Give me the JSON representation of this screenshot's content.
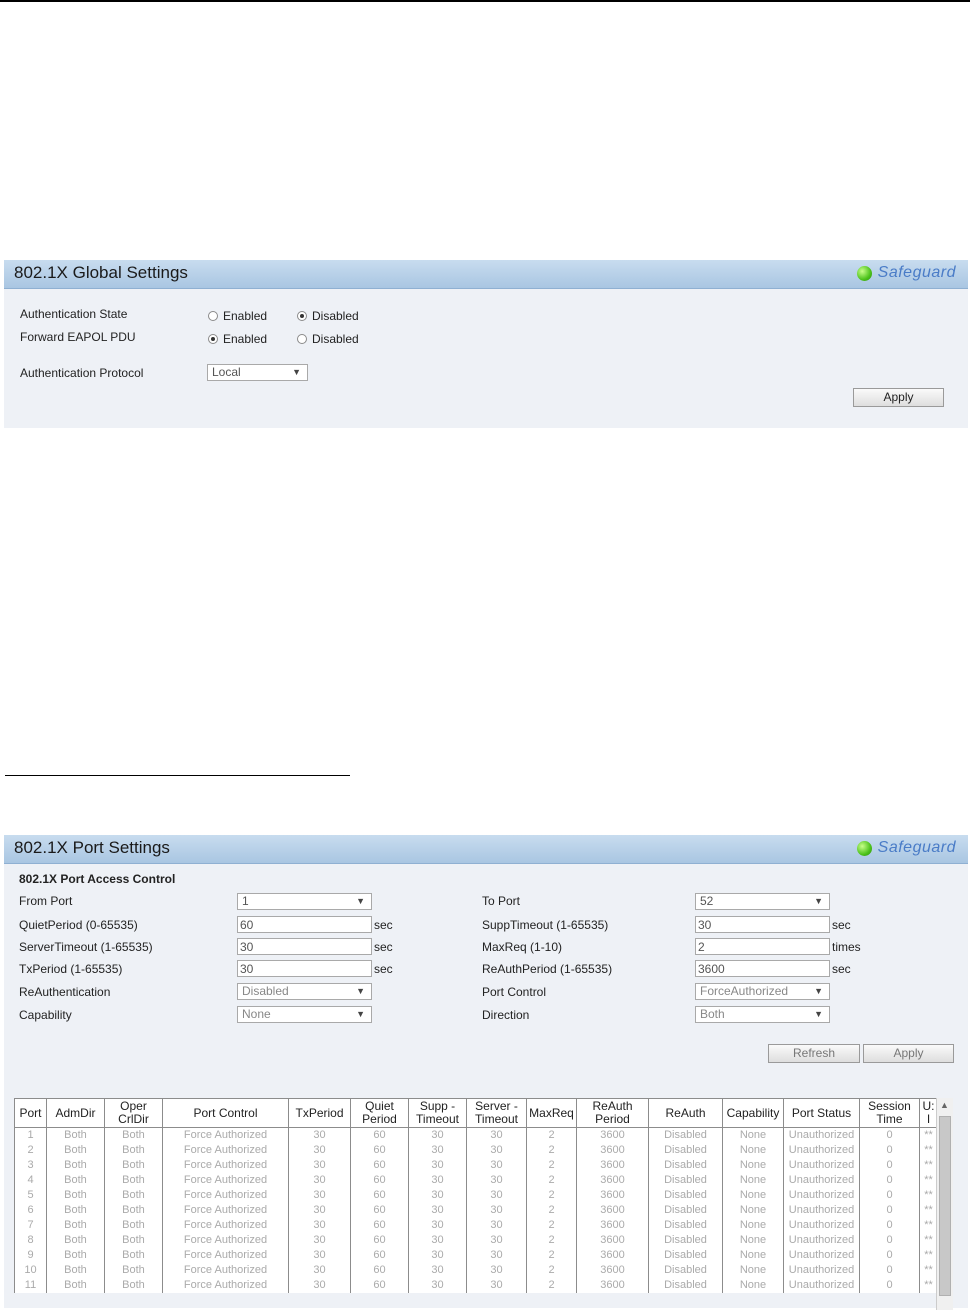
{
  "global_panel": {
    "title": "802.1X Global Settings",
    "safeguard": "Safeguard",
    "auth_state_label": "Authentication State",
    "auth_state_options": [
      "Enabled",
      "Disabled"
    ],
    "auth_state_selected": "Disabled",
    "eapol_label": "Forward EAPOL PDU",
    "eapol_options": [
      "Enabled",
      "Disabled"
    ],
    "eapol_selected": "Enabled",
    "protocol_label": "Authentication Protocol",
    "protocol_value": "Local",
    "apply": "Apply"
  },
  "port_panel": {
    "title": "802.1X Port Settings",
    "safeguard": "Safeguard",
    "section": "802.1X Port Access Control",
    "from_port_label": "From Port",
    "from_port_value": "1",
    "to_port_label": "To Port",
    "to_port_value": "52",
    "quiet_label": "QuietPeriod (0-65535)",
    "quiet_value": "60",
    "quiet_unit": "sec",
    "supp_label": "SuppTimeout (1-65535)",
    "supp_value": "30",
    "supp_unit": "sec",
    "server_label": "ServerTimeout (1-65535)",
    "server_value": "30",
    "server_unit": "sec",
    "maxreq_label": "MaxReq (1-10)",
    "maxreq_value": "2",
    "maxreq_unit": "times",
    "tx_label": "TxPeriod (1-65535)",
    "tx_value": "30",
    "tx_unit": "sec",
    "reauthp_label": "ReAuthPeriod (1-65535)",
    "reauthp_value": "3600",
    "reauthp_unit": "sec",
    "reauth_label": "ReAuthentication",
    "reauth_value": "Disabled",
    "portctrl_label": "Port Control",
    "portctrl_value": "ForceAuthorized",
    "capability_label": "Capability",
    "capability_value": "None",
    "direction_label": "Direction",
    "direction_value": "Both",
    "refresh": "Refresh",
    "apply": "Apply"
  },
  "table": {
    "headers": [
      "Port",
      "AdmDir",
      "Oper CrlDir",
      "Port Control",
      "TxPeriod",
      "Quiet Period",
      "Supp - Timeout",
      "Server - Timeout",
      "MaxReq",
      "ReAuth Period",
      "ReAuth",
      "Capability",
      "Port Status",
      "Session Time",
      "U: I"
    ],
    "rows": [
      [
        "1",
        "Both",
        "Both",
        "Force Authorized",
        "30",
        "60",
        "30",
        "30",
        "2",
        "3600",
        "Disabled",
        "None",
        "Unauthorized",
        "0",
        "**"
      ],
      [
        "2",
        "Both",
        "Both",
        "Force Authorized",
        "30",
        "60",
        "30",
        "30",
        "2",
        "3600",
        "Disabled",
        "None",
        "Unauthorized",
        "0",
        "**"
      ],
      [
        "3",
        "Both",
        "Both",
        "Force Authorized",
        "30",
        "60",
        "30",
        "30",
        "2",
        "3600",
        "Disabled",
        "None",
        "Unauthorized",
        "0",
        "**"
      ],
      [
        "4",
        "Both",
        "Both",
        "Force Authorized",
        "30",
        "60",
        "30",
        "30",
        "2",
        "3600",
        "Disabled",
        "None",
        "Unauthorized",
        "0",
        "**"
      ],
      [
        "5",
        "Both",
        "Both",
        "Force Authorized",
        "30",
        "60",
        "30",
        "30",
        "2",
        "3600",
        "Disabled",
        "None",
        "Unauthorized",
        "0",
        "**"
      ],
      [
        "6",
        "Both",
        "Both",
        "Force Authorized",
        "30",
        "60",
        "30",
        "30",
        "2",
        "3600",
        "Disabled",
        "None",
        "Unauthorized",
        "0",
        "**"
      ],
      [
        "7",
        "Both",
        "Both",
        "Force Authorized",
        "30",
        "60",
        "30",
        "30",
        "2",
        "3600",
        "Disabled",
        "None",
        "Unauthorized",
        "0",
        "**"
      ],
      [
        "8",
        "Both",
        "Both",
        "Force Authorized",
        "30",
        "60",
        "30",
        "30",
        "2",
        "3600",
        "Disabled",
        "None",
        "Unauthorized",
        "0",
        "**"
      ],
      [
        "9",
        "Both",
        "Both",
        "Force Authorized",
        "30",
        "60",
        "30",
        "30",
        "2",
        "3600",
        "Disabled",
        "None",
        "Unauthorized",
        "0",
        "**"
      ],
      [
        "10",
        "Both",
        "Both",
        "Force Authorized",
        "30",
        "60",
        "30",
        "30",
        "2",
        "3600",
        "Disabled",
        "None",
        "Unauthorized",
        "0",
        "**"
      ],
      [
        "11",
        "Both",
        "Both",
        "Force Authorized",
        "30",
        "60",
        "30",
        "30",
        "2",
        "3600",
        "Disabled",
        "None",
        "Unauthorized",
        "0",
        "**"
      ]
    ]
  }
}
